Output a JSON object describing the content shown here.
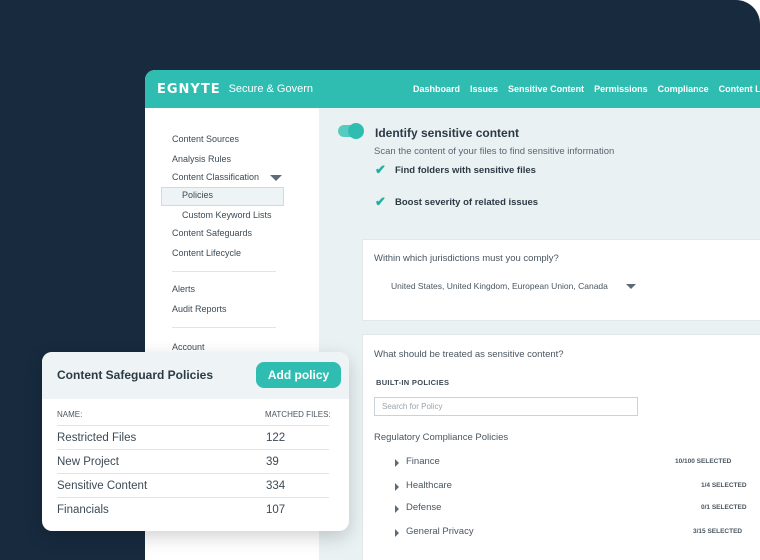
{
  "header": {
    "logo": "EGNYTE",
    "product": "Secure & Govern",
    "nav": [
      "Dashboard",
      "Issues",
      "Sensitive Content",
      "Permissions",
      "Compliance",
      "Content Lifecycle"
    ]
  },
  "sidebar": {
    "items": [
      {
        "label": "Content Sources"
      },
      {
        "label": "Analysis Rules"
      },
      {
        "label": "Content Classification"
      },
      {
        "label": "Policies"
      },
      {
        "label": "Custom Keyword Lists"
      },
      {
        "label": "Content Safeguards"
      },
      {
        "label": "Content Lifecycle"
      },
      {
        "label": "Alerts"
      },
      {
        "label": "Audit Reports"
      },
      {
        "label": "Account"
      }
    ]
  },
  "main": {
    "identify": {
      "title": "Identify sensitive content",
      "subtitle": "Scan the content of your files to find sensitive information",
      "options": [
        "Find folders with sensitive files",
        "Boost severity of related issues"
      ]
    },
    "jurisdictions": {
      "question": "Within which jurisdictions must you comply?",
      "value": "United States, United Kingdom, European Union, Canada"
    },
    "sensitive": {
      "question": "What should be treated as sensitive content?",
      "builtin_label": "BUILT-IN POLICIES",
      "search_placeholder": "Search for Policy",
      "group_title": "Regulatory Compliance Policies",
      "policies": [
        {
          "name": "Finance",
          "count": "10/100 SELECTED"
        },
        {
          "name": "Healthcare",
          "count": "1/4 SELECTED"
        },
        {
          "name": "Defense",
          "count": "0/1 SELECTED"
        },
        {
          "name": "General Privacy",
          "count": "3/15 SELECTED"
        }
      ]
    }
  },
  "overlay": {
    "title": "Content Safeguard Policies",
    "add_button": "Add policy",
    "col_name": "NAME:",
    "col_matched": "MATCHED FILES:",
    "rows": [
      {
        "name": "Restricted Files",
        "matched": "122"
      },
      {
        "name": "New Project",
        "matched": "39"
      },
      {
        "name": "Sensitive Content",
        "matched": "334"
      },
      {
        "name": "Financials",
        "matched": "107"
      }
    ]
  },
  "colors": {
    "accent": "#2fbdb1",
    "dark_bg": "#172a3e"
  }
}
